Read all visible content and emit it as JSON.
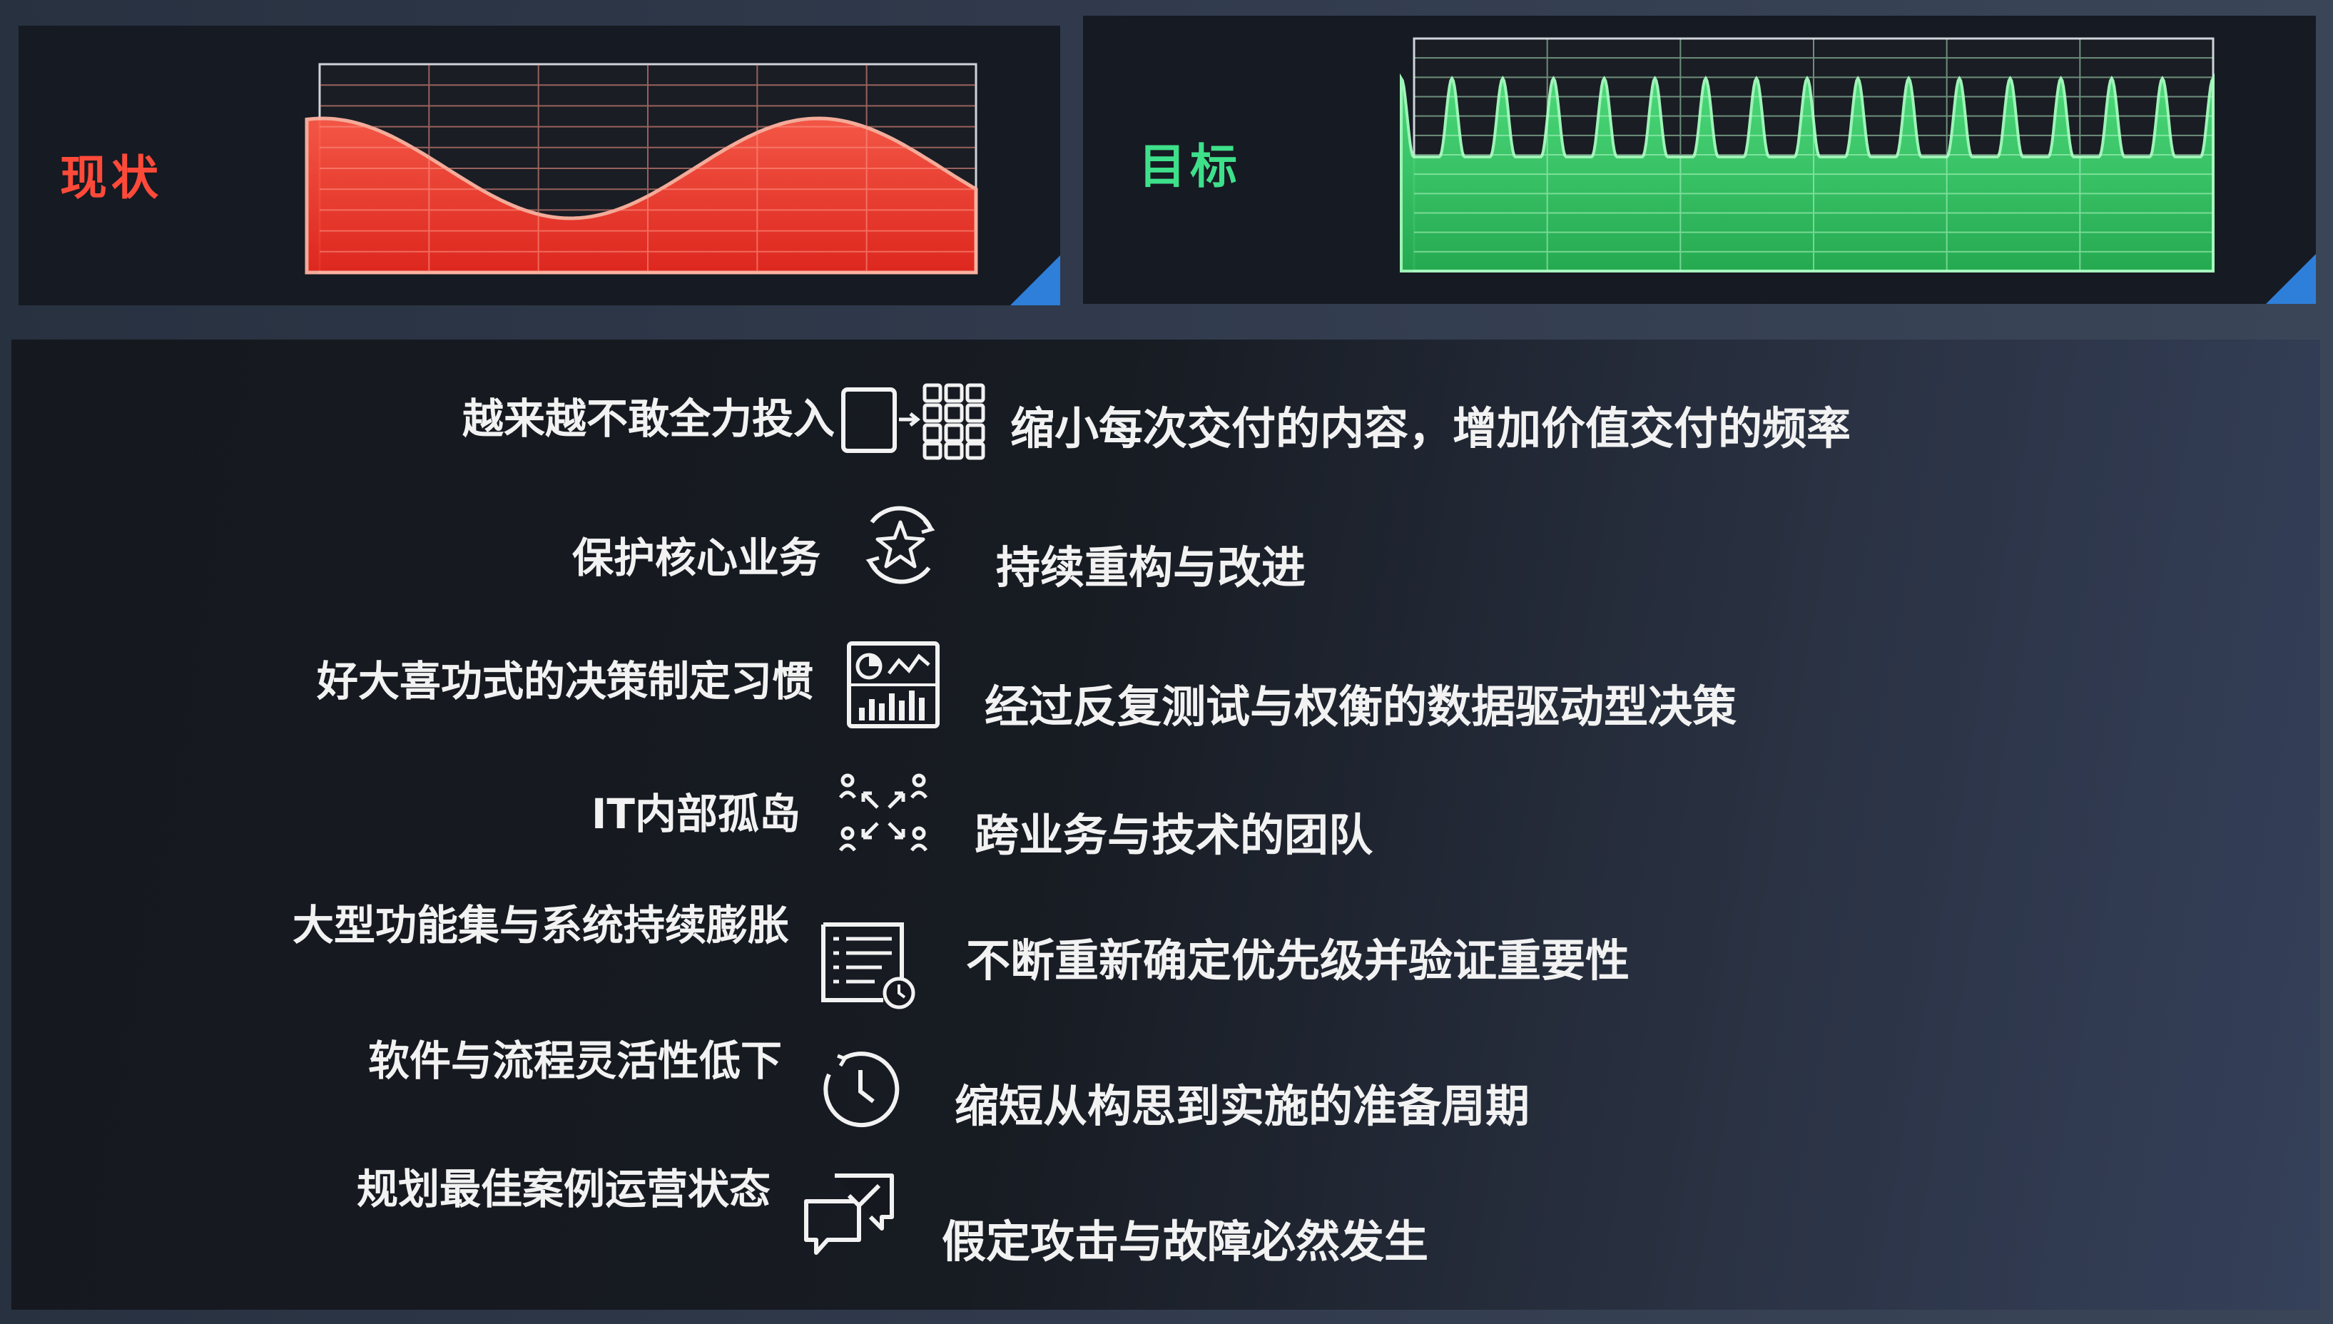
{
  "current": {
    "label": "现状",
    "color": "#ff3b30"
  },
  "target": {
    "label": "目标",
    "color": "#35d36b"
  },
  "rows": [
    {
      "problem": "越来越不敢全力投入",
      "icon": "grid-split-icon",
      "solution": "缩小每次交付的内容，增加价值交付的频率"
    },
    {
      "problem": "保护核心业务",
      "icon": "star-cycle-icon",
      "solution": "持续重构与改进"
    },
    {
      "problem": "好大喜功式的决策制定习惯",
      "icon": "dashboard-icon",
      "solution": "经过反复测试与权衡的数据驱动型决策"
    },
    {
      "problem": "IT内部孤岛",
      "icon": "team-network-icon",
      "solution": "跨业务与技术的团队"
    },
    {
      "problem": "大型功能集与系统持续膨胀",
      "icon": "list-clock-icon",
      "solution": "不断重新确定优先级并验证重要性"
    },
    {
      "problem": "软件与流程灵活性低下",
      "icon": "clock-icon",
      "solution": "缩短从构思到实施的准备周期"
    },
    {
      "problem": "规划最佳案例运营状态",
      "icon": "chat-check-icon",
      "solution": "假定攻击与故障必然发生"
    }
  ]
}
